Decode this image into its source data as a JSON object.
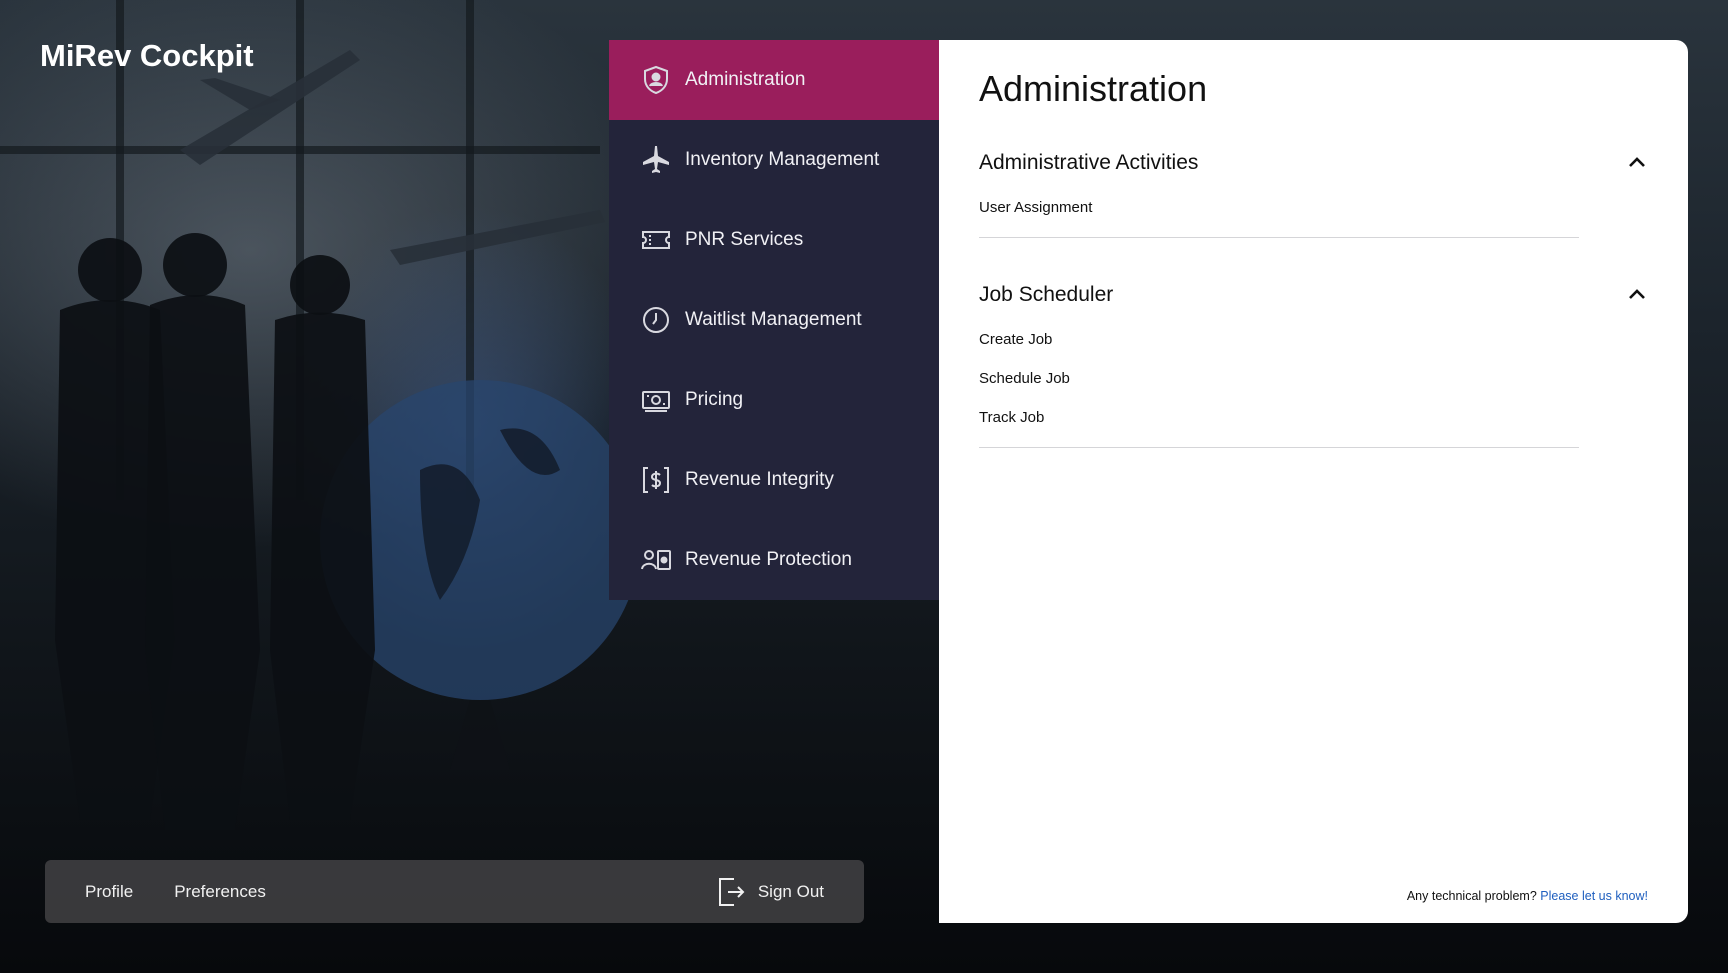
{
  "app": {
    "title": "MiRev Cockpit"
  },
  "menu": {
    "items": [
      {
        "label": "Administration",
        "icon": "shield-user-icon",
        "active": true
      },
      {
        "label": "Inventory Management",
        "icon": "airplane-icon",
        "active": false
      },
      {
        "label": "PNR Services",
        "icon": "ticket-icon",
        "active": false
      },
      {
        "label": "Waitlist Management",
        "icon": "clock-icon",
        "active": false
      },
      {
        "label": "Pricing",
        "icon": "banknote-icon",
        "active": false
      },
      {
        "label": "Revenue Integrity",
        "icon": "dollar-bracket-icon",
        "active": false
      },
      {
        "label": "Revenue Protection",
        "icon": "user-shield-icon",
        "active": false
      }
    ],
    "active_color": "#9a1e5c",
    "background_color": "#23243a"
  },
  "panel": {
    "title": "Administration",
    "sections": [
      {
        "title": "Administrative Activities",
        "expanded": true,
        "links": [
          "User Assignment"
        ]
      },
      {
        "title": "Job Scheduler",
        "expanded": true,
        "links": [
          "Create Job",
          "Schedule Job",
          "Track Job"
        ]
      }
    ],
    "support": {
      "text": "Any technical problem?",
      "link1": "Please",
      "link2": "let us know!"
    }
  },
  "bottom_bar": {
    "profile": "Profile",
    "preferences": "Preferences",
    "signout": "Sign Out"
  }
}
